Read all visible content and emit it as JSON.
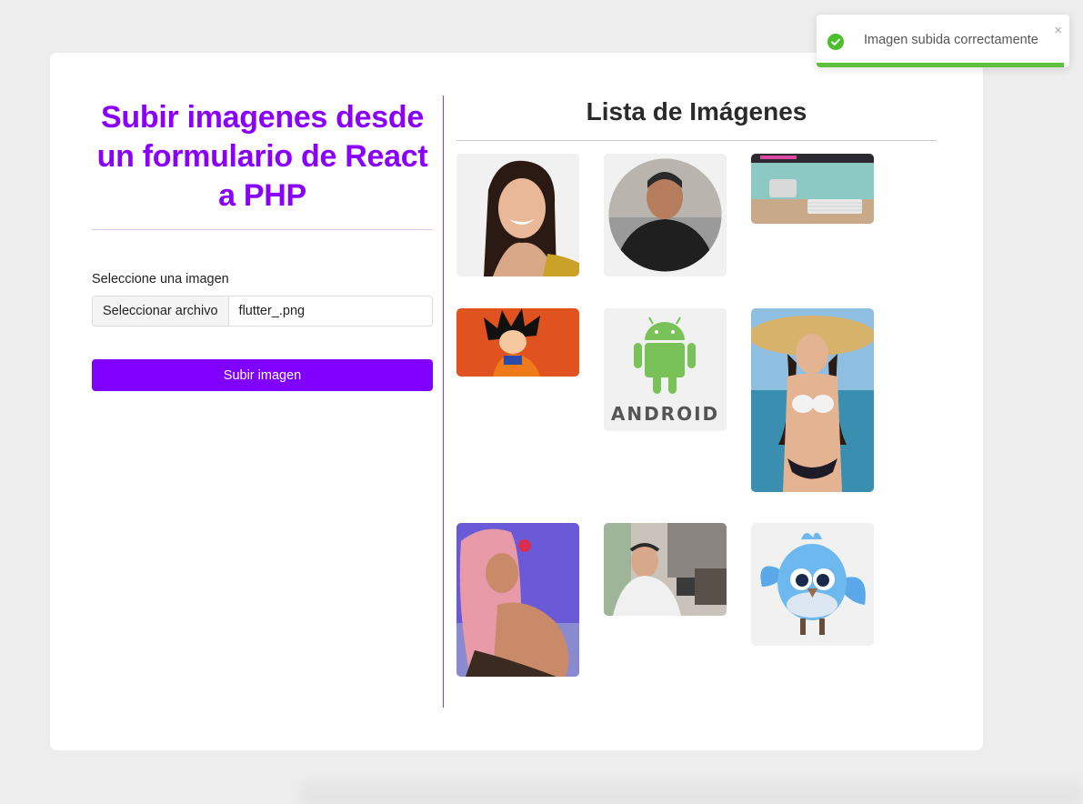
{
  "form": {
    "title": "Subir imagenes desde un formulario de React a PHP",
    "field_label": "Seleccione una imagen",
    "file_button_label": "Seleccionar archivo",
    "file_name": "flutter_.png",
    "submit_label": "Subir imagen"
  },
  "gallery": {
    "title": "Lista de Imágenes",
    "images": [
      {
        "subject": "woman smiling portrait"
      },
      {
        "subject": "man in black hoodie round avatar"
      },
      {
        "subject": "desktop computer on desk"
      },
      {
        "subject": "goku anime character"
      },
      {
        "subject": "android logo"
      },
      {
        "subject": "woman in straw hat at beach"
      },
      {
        "subject": "woman with pink hair"
      },
      {
        "subject": "man selfie in office"
      },
      {
        "subject": "blue bird 3d mascot"
      }
    ]
  },
  "toast": {
    "message": "Imagen subida correctamente",
    "close_glyph": "×",
    "progress": 0.98,
    "success_color": "#4bbf2b"
  },
  "colors": {
    "accent": "#8000ff",
    "title": "#8a00ff",
    "progress": "#5cc13a"
  }
}
